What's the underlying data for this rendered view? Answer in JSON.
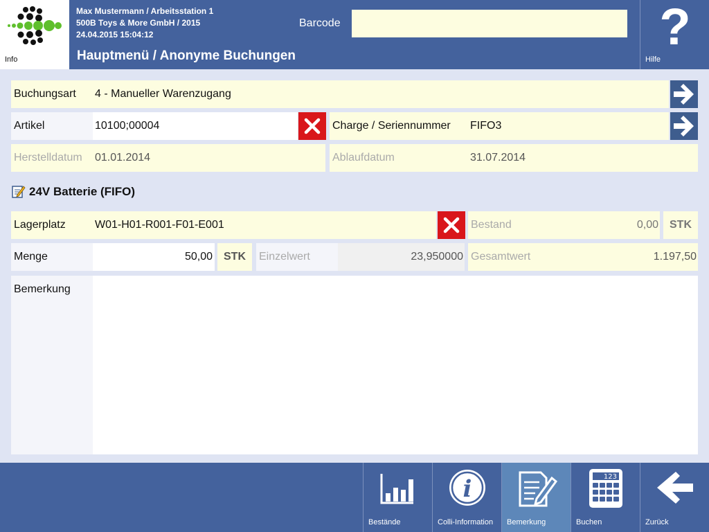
{
  "header": {
    "info_label": "Info",
    "user_line": "Max Mustermann / Arbeitsstation 1",
    "company_line": "500B Toys & More GmbH / 2015",
    "datetime_line": "24.04.2015 15:04:12",
    "title": "Hauptmenü / Anonyme Buchungen",
    "barcode_label": "Barcode",
    "barcode_value": "",
    "help_label": "Hilfe",
    "help_glyph": "?"
  },
  "form": {
    "buchungsart": {
      "label": "Buchungsart",
      "value": "4 - Manueller Warenzugang"
    },
    "artikel": {
      "label": "Artikel",
      "value": "10100;00004"
    },
    "charge": {
      "label": "Charge / Seriennummer",
      "value": "FIFO3"
    },
    "herstelldatum": {
      "label": "Herstelldatum",
      "value": "01.01.2014"
    },
    "ablaufdatum": {
      "label": "Ablaufdatum",
      "value": "31.07.2014"
    },
    "item_title": "24V Batterie (FIFO)",
    "lagerplatz": {
      "label": "Lagerplatz",
      "value": "W01-H01-R001-F01-E001"
    },
    "bestand": {
      "label": "Bestand",
      "value": "0,00",
      "unit": "STK"
    },
    "menge": {
      "label": "Menge",
      "value": "50,00",
      "unit": "STK"
    },
    "einzelwert": {
      "label": "Einzelwert",
      "value": "23,950000"
    },
    "gesamtwert": {
      "label": "Gesamtwert",
      "value": "1.197,50"
    },
    "bemerkung": {
      "label": "Bemerkung",
      "value": ""
    }
  },
  "footer": {
    "buttons": [
      {
        "label": "Bestände",
        "icon": "bar-chart-icon"
      },
      {
        "label": "Colli-Information",
        "icon": "info-icon"
      },
      {
        "label": "Bemerkung",
        "icon": "note-edit-icon",
        "active": true
      },
      {
        "label": "Buchen",
        "icon": "calculator-icon",
        "display": "123"
      },
      {
        "label": "Zurück",
        "icon": "back-arrow-icon"
      }
    ]
  },
  "colors": {
    "header_blue": "#44629d",
    "field_yellow": "#fdfde0",
    "arrow_button": "#3e5d8e",
    "clear_red": "#d9161b",
    "active_button": "#5d87b9",
    "logo_green": "#5fbf2c"
  }
}
